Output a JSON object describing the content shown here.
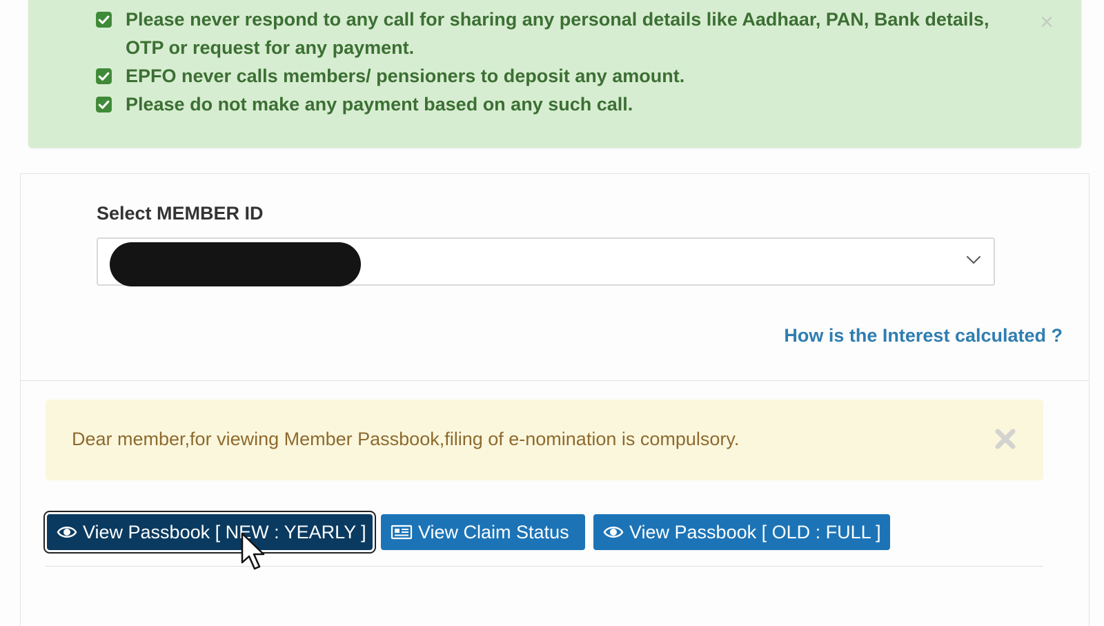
{
  "warnings": {
    "items": [
      "Please never respond to any call for sharing any personal details like Aadhaar, PAN, Bank details, OTP or request for any payment.",
      "EPFO never calls members/ pensioners to deposit any amount.",
      "Please do not make any payment based on any such call."
    ],
    "close_icon": "×"
  },
  "member": {
    "label": "Select MEMBER ID",
    "selected_value": ""
  },
  "interest_link": "How is the Interest calculated ?",
  "notice": {
    "text": "Dear member,for viewing Member Passbook,filing of e-nomination is compulsory."
  },
  "buttons": {
    "passbook_new": "View Passbook [ NEW : YEARLY ]",
    "claim_status": "View Claim Status",
    "passbook_old": "View Passbook [ OLD : FULL ]"
  },
  "icons": {
    "check": "check-square-icon",
    "eye": "eye-icon",
    "claim": "newspaper-icon",
    "chevron": "chevron-down-icon",
    "close": "close-icon"
  },
  "colors": {
    "alert_success_bg": "#d7edd1",
    "alert_success_text": "#3c6f34",
    "check_green": "#3f8a38",
    "link_blue": "#2f7db0",
    "alert_warning_bg": "#fbf7dd",
    "alert_warning_text": "#8d6a2e",
    "button_blue": "#1c74b7",
    "button_active": "#0a3a60"
  }
}
